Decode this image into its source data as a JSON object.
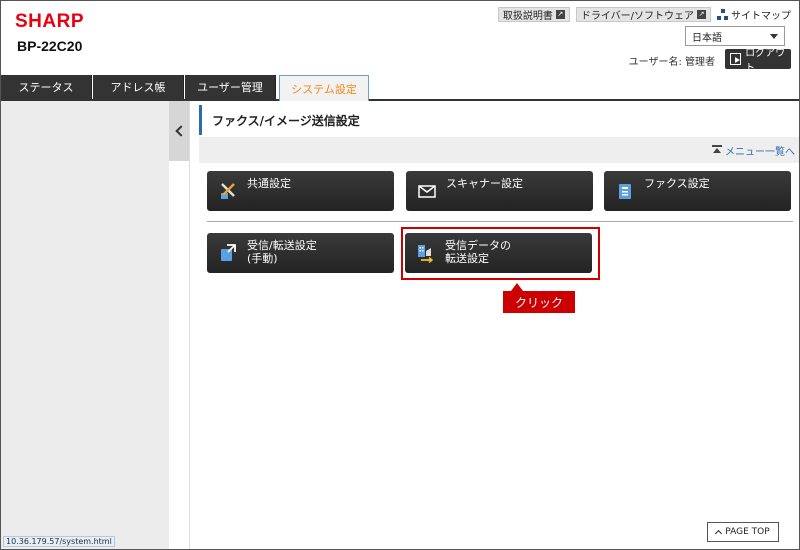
{
  "header": {
    "brand": "SHARP",
    "model": "BP-22C20",
    "links": [
      {
        "label": "取扱説明書"
      },
      {
        "label": "ドライバー/ソフトウェア"
      }
    ],
    "sitemap_label": "サイトマップ",
    "language": "日本語",
    "user_line": "ユーザー名: 管理者",
    "logout_label": "ログアウト"
  },
  "tabs": [
    {
      "label": "ステータス"
    },
    {
      "label": "アドレス帳"
    },
    {
      "label": "ユーザー管理"
    },
    {
      "label": "システム設定"
    }
  ],
  "page": {
    "title": "ファクス/イメージ送信設定",
    "menu_link": "メニュー一覧へ"
  },
  "buttons": [
    {
      "line1": "共通設定",
      "line2": "",
      "icon": "tools-icon"
    },
    {
      "line1": "スキャナー設定",
      "line2": "",
      "icon": "envelope-icon"
    },
    {
      "line1": "ファクス設定",
      "line2": "",
      "icon": "fax-icon"
    },
    {
      "line1": "受信/転送設定",
      "line2": "(手動)",
      "icon": "inbox-forward-icon"
    },
    {
      "line1": "受信データの",
      "line2": "転送設定",
      "icon": "data-forward-icon"
    }
  ],
  "annotation": {
    "callout": "クリック"
  },
  "footer": {
    "page_top": "PAGE TOP",
    "status_url": "10.36.179.57/system.html"
  },
  "colors": {
    "brand": "#e60012",
    "active_tab_text": "#f08a1c",
    "accent_blue": "#2e6ab0",
    "highlight": "#cc0000"
  }
}
